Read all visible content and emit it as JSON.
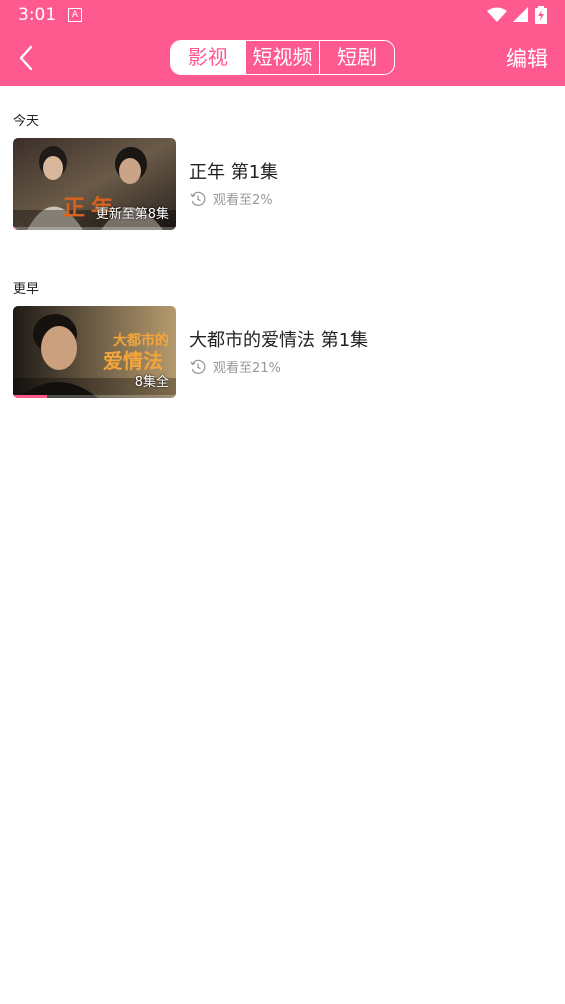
{
  "status_bar": {
    "time": "3:01",
    "a_badge": "A",
    "icons": [
      "wifi-icon",
      "signal-icon",
      "battery-charging-icon"
    ]
  },
  "header": {
    "back_icon": "chevron-left-icon",
    "tabs": [
      {
        "label": "影视",
        "active": true
      },
      {
        "label": "短视频",
        "active": false
      },
      {
        "label": "短剧",
        "active": false
      }
    ],
    "edit_label": "编辑"
  },
  "sections": [
    {
      "label": "今天",
      "items": [
        {
          "title": "正年  第1集",
          "badge": "更新至第8集",
          "watched": "观看至2%",
          "progress": 0.02,
          "thumb_text": "正年"
        }
      ]
    },
    {
      "label": "更早",
      "items": [
        {
          "title": "大都市的爱情法  第1集",
          "badge": "8集全",
          "watched": "观看至21%",
          "progress": 0.21,
          "thumb_text_line1": "大都市的",
          "thumb_text_line2": "爱情法"
        }
      ]
    }
  ],
  "colors": {
    "accent": "#ff5a8f",
    "text_primary": "#222222",
    "text_secondary": "#999999"
  }
}
